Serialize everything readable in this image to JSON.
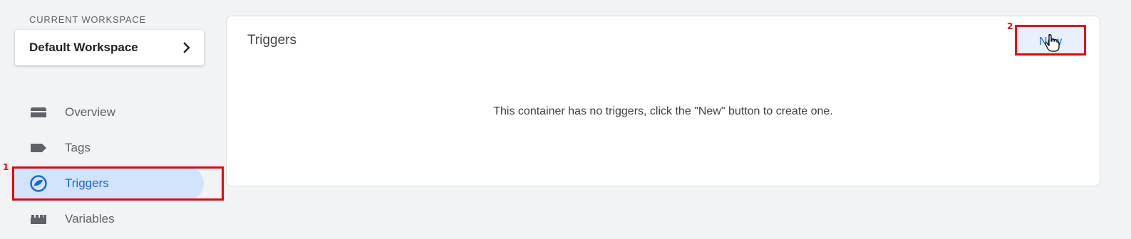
{
  "sidebar": {
    "workspace_section_label": "CURRENT WORKSPACE",
    "workspace_name": "Default Workspace",
    "items": [
      {
        "label": "Overview",
        "icon": "folder-icon",
        "active": false
      },
      {
        "label": "Tags",
        "icon": "tag-icon",
        "active": false
      },
      {
        "label": "Triggers",
        "icon": "triggers-icon",
        "active": true
      },
      {
        "label": "Variables",
        "icon": "variables-icon",
        "active": false
      }
    ]
  },
  "main": {
    "title": "Triggers",
    "new_button_label": "New",
    "empty_message": "This container has no triggers, click the \"New\" button to create one."
  },
  "annotations": [
    {
      "number": "1",
      "target": "sidebar-item-triggers"
    },
    {
      "number": "2",
      "target": "new-button"
    }
  ],
  "colors": {
    "page_background": "#f1f3f4",
    "active_nav_background": "#d2e3fc",
    "accent_blue": "#1967d2",
    "button_background": "#e8f0fe",
    "annotation_red": "#e8000b"
  }
}
